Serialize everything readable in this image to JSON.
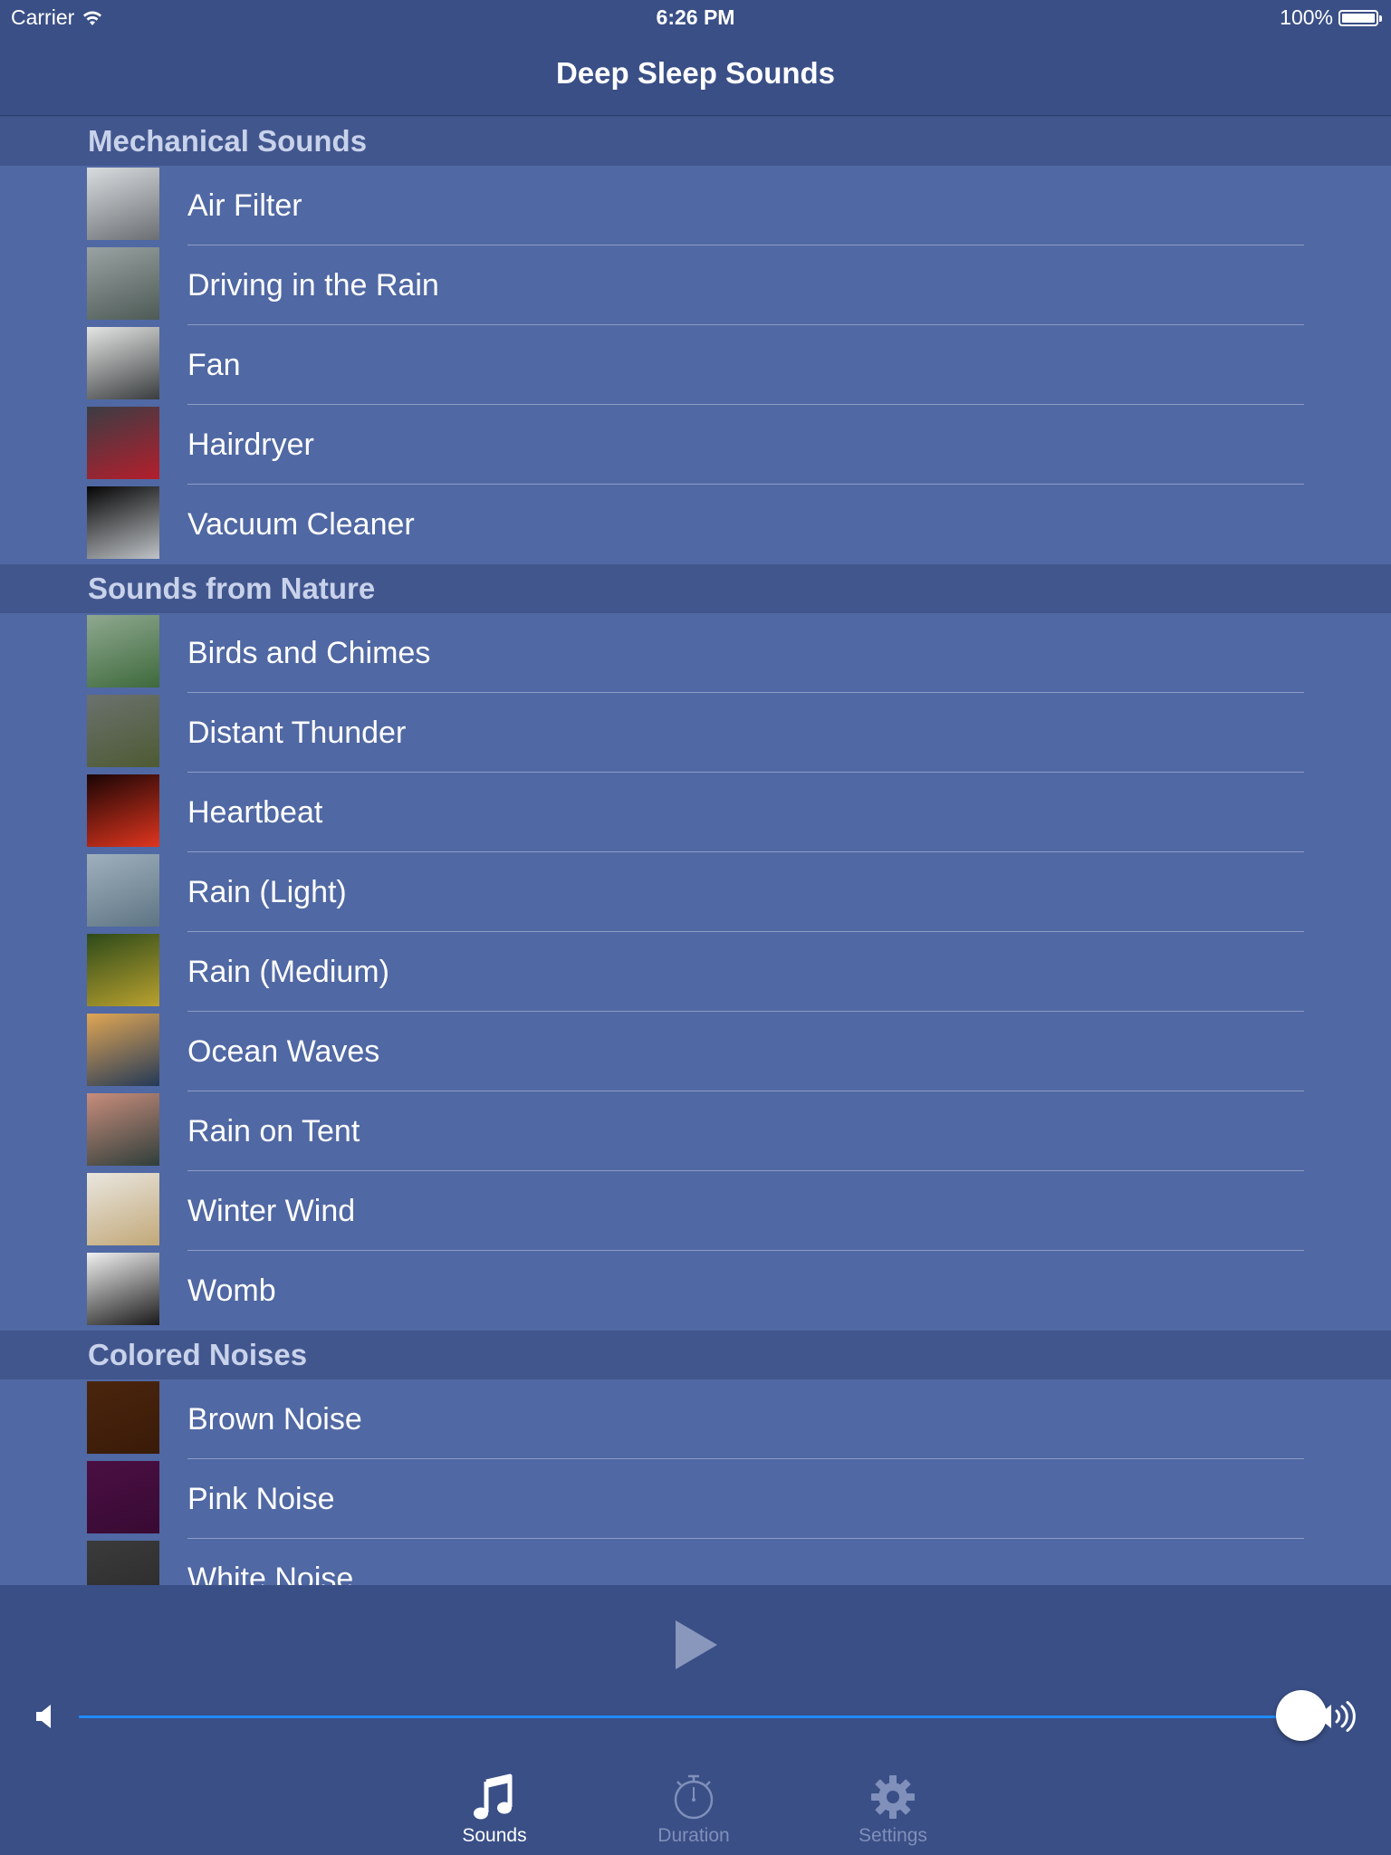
{
  "status_bar": {
    "carrier": "Carrier",
    "time": "6:26 PM",
    "battery": "100%",
    "battery_level": 1.0
  },
  "nav": {
    "title": "Deep Sleep Sounds"
  },
  "sections": [
    {
      "title": "Mechanical Sounds",
      "items": [
        {
          "label": "Air Filter",
          "thumb_colors": [
            "#d9dcdf",
            "#6b6f73"
          ]
        },
        {
          "label": "Driving in the Rain",
          "thumb_colors": [
            "#9aa3a3",
            "#4d5a55"
          ]
        },
        {
          "label": "Fan",
          "thumb_colors": [
            "#e4e6e4",
            "#3a3d3f"
          ]
        },
        {
          "label": "Hairdryer",
          "thumb_colors": [
            "#3b3d44",
            "#b41e2c"
          ]
        },
        {
          "label": "Vacuum Cleaner",
          "thumb_colors": [
            "#050505",
            "#bfc3c7"
          ]
        }
      ]
    },
    {
      "title": "Sounds from Nature",
      "items": [
        {
          "label": "Birds and Chimes",
          "thumb_colors": [
            "#8fa890",
            "#3e6a3c"
          ]
        },
        {
          "label": "Distant Thunder",
          "thumb_colors": [
            "#6b716e",
            "#4e5a33"
          ]
        },
        {
          "label": "Heartbeat",
          "thumb_colors": [
            "#1a0505",
            "#e0351e"
          ]
        },
        {
          "label": "Rain (Light)",
          "thumb_colors": [
            "#9fb0bd",
            "#5f7584"
          ]
        },
        {
          "label": "Rain (Medium)",
          "thumb_colors": [
            "#2d4a1a",
            "#b9a12e"
          ]
        },
        {
          "label": "Ocean Waves",
          "thumb_colors": [
            "#e0a654",
            "#243957"
          ]
        },
        {
          "label": "Rain on Tent",
          "thumb_colors": [
            "#c88d7c",
            "#2f3e3a"
          ]
        },
        {
          "label": "Winter Wind",
          "thumb_colors": [
            "#e9e6df",
            "#c2a878"
          ]
        },
        {
          "label": "Womb",
          "thumb_colors": [
            "#f1f1f1",
            "#1a1a1a"
          ]
        }
      ]
    },
    {
      "title": "Colored Noises",
      "items": [
        {
          "label": "Brown Noise",
          "thumb_colors": [
            "#4a250d",
            "#3a1b08"
          ]
        },
        {
          "label": "Pink Noise",
          "thumb_colors": [
            "#4a0f42",
            "#380a33"
          ]
        },
        {
          "label": "White Noise",
          "thumb_colors": [
            "#3b3b3b",
            "#2a2a2a"
          ]
        }
      ]
    }
  ],
  "player": {
    "play_icon": "play-icon",
    "volume_level": 0.9835,
    "volume_low_icon": "speaker-low-icon",
    "volume_high_icon": "speaker-high-icon"
  },
  "tabs": [
    {
      "label": "Sounds",
      "icon": "music-note-icon",
      "active": true
    },
    {
      "label": "Duration",
      "icon": "stopwatch-icon",
      "active": false
    },
    {
      "label": "Settings",
      "icon": "gear-icon",
      "active": false
    }
  ],
  "colors": {
    "background": "#3a4f86",
    "row": "#5068a3",
    "section_header": "#42568e",
    "accent": "#1f8bff",
    "inactive_tab": "#8090ba"
  }
}
